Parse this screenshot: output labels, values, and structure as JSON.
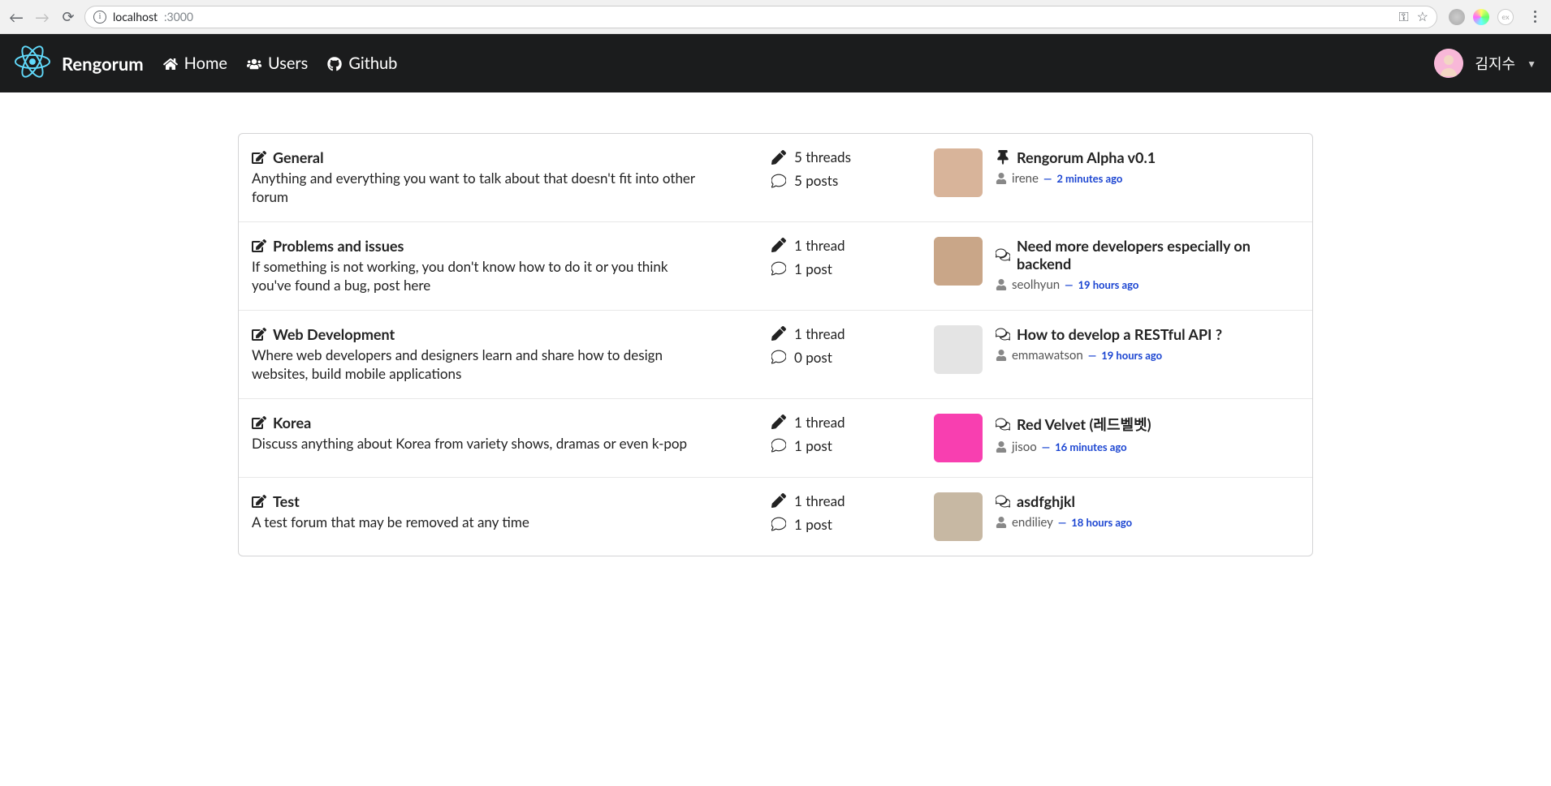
{
  "browser": {
    "url_host": "localhost",
    "url_port": ":3000"
  },
  "navbar": {
    "brand": "Rengorum",
    "links": [
      {
        "label": "Home",
        "icon": "home-icon"
      },
      {
        "label": "Users",
        "icon": "users-icon"
      },
      {
        "label": "Github",
        "icon": "github-icon"
      }
    ],
    "user": {
      "name": "김지수"
    }
  },
  "forums": [
    {
      "name": "General",
      "description": "Anything and everything you want to talk about that doesn't fit into other forum",
      "threads": "5 threads",
      "posts": "5 posts",
      "last": {
        "pinned": true,
        "title": "Rengorum Alpha v0.1",
        "user": "irene",
        "time": "2 minutes ago",
        "avatar_bg": "#d8b49a"
      }
    },
    {
      "name": "Problems and issues",
      "description": "If something is not working, you don't know how to do it or you think you've found a bug, post here",
      "threads": "1 thread",
      "posts": "1 post",
      "last": {
        "pinned": false,
        "title": "Need more developers especially on backend",
        "user": "seolhyun",
        "time": "19 hours ago",
        "avatar_bg": "#c9a688"
      }
    },
    {
      "name": "Web Development",
      "description": "Where web developers and designers learn and share how to design websites, build mobile applications",
      "threads": "1 thread",
      "posts": "0 post",
      "last": {
        "pinned": false,
        "title": "How to develop a RESTful API ?",
        "user": "emmawatson",
        "time": "19 hours ago",
        "avatar_bg": "#e4e4e4"
      }
    },
    {
      "name": "Korea",
      "description": "Discuss anything about Korea from variety shows, dramas or even k-pop",
      "threads": "1 thread",
      "posts": "1 post",
      "last": {
        "pinned": false,
        "title": "Red Velvet (레드벨벳)",
        "user": "jisoo",
        "time": "16 minutes ago",
        "avatar_bg": "#f83fb0"
      }
    },
    {
      "name": "Test",
      "description": "A test forum that may be removed at any time",
      "threads": "1 thread",
      "posts": "1 post",
      "last": {
        "pinned": false,
        "title": "asdfghjkl",
        "user": "endiliey",
        "time": "18 hours ago",
        "avatar_bg": "#c7b8a3"
      }
    }
  ]
}
